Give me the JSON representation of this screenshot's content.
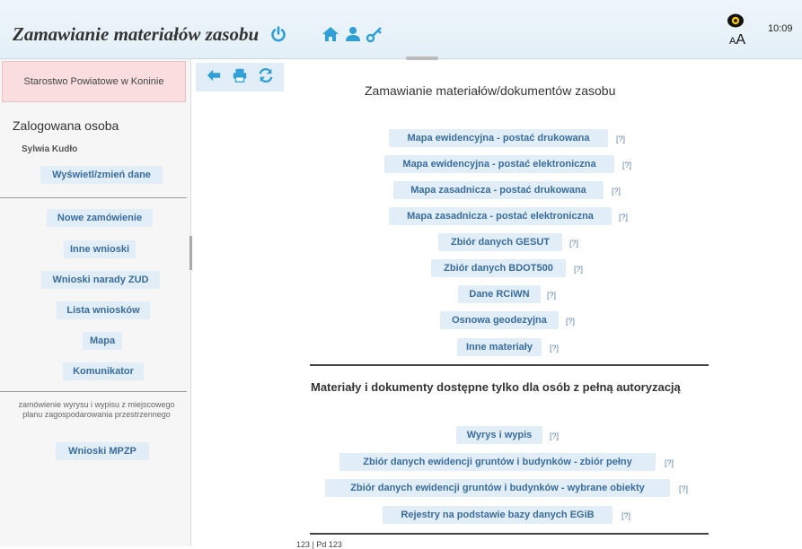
{
  "header": {
    "title": "Zamawianie materiałów zasobu",
    "time": "10:09",
    "font_size_label_small": "A",
    "font_size_label_large": "A",
    "icons": [
      "power-icon",
      "home-icon",
      "user-icon",
      "key-icon",
      "eye-icon"
    ]
  },
  "sidebar": {
    "office": "Starostwo Powiatowe w Koninie",
    "logged_label": "Zalogowana osoba",
    "user_name": "Sylwia Kudło",
    "view_data": "Wyświetl/zmień dane",
    "items": [
      "Nowe zamówienie",
      "Inne wnioski",
      "Wnioski narady ZUD",
      "Lista wniosków",
      "Mapa",
      "Komunikator"
    ],
    "mpzp_note": "zamówienie wyrysu i wypisu z miejscowego planu zagospodarowania przestrzennego",
    "mpzp_button": "Wnioski MPZP"
  },
  "toolbar": {
    "icons": [
      "back-arrow-icon",
      "print-icon",
      "refresh-icon"
    ]
  },
  "main": {
    "title": "Zamawianie materiałów/dokumentów zasobu",
    "help_label": "[?]",
    "links": [
      "Mapa ewidencyjna - postać drukowana",
      "Mapa ewidencyjna - postać elektroniczna",
      "Mapa zasadnicza - postać drukowana",
      "Mapa zasadnicza - postać elektroniczna",
      "Zbiór danych GESUT",
      "Zbiór danych BDOT500",
      "Dane RCiWN",
      "Osnowa geodezyjna",
      "Inne materiały"
    ],
    "auth_title": "Materiały i dokumenty dostępne tylko dla osób z pełną autoryzacją",
    "auth_links": [
      "Wyrys i wypis",
      "Zbiór danych ewidencji gruntów i budynków - zbiór pełny",
      "Zbiór danych ewidencji gruntów i budynków - wybrane obiekty",
      "Rejestry na podstawie bazy danych EGiB"
    ],
    "footer": "123 | Pd 123"
  },
  "colors": {
    "accent": "#2f9fd6",
    "button_bg": "#e1edf7",
    "button_text": "#3a6d9c",
    "office_bg": "#fadedf"
  }
}
